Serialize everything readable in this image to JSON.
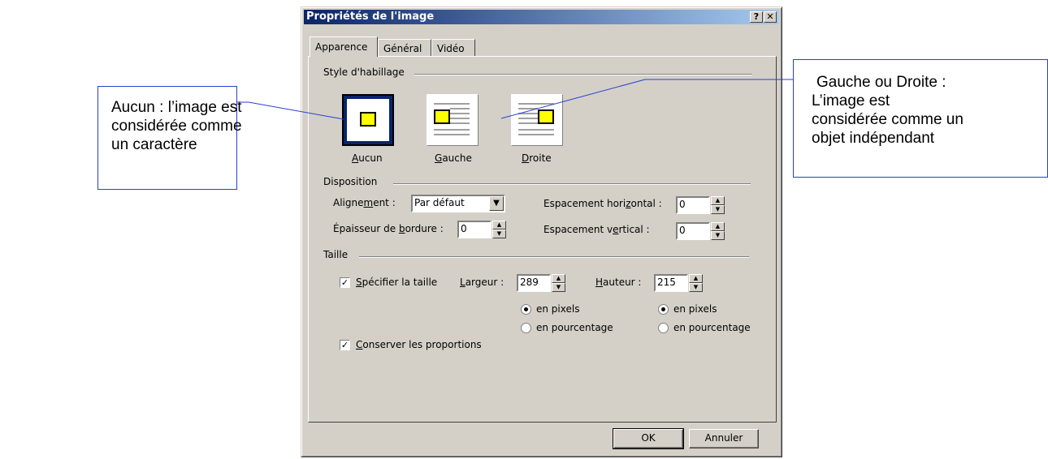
{
  "callouts": {
    "left": {
      "line1": "Aucun : l’image est",
      "line2": "considérée comme",
      "line3": "un caractère"
    },
    "right": {
      "line1": "Gauche ou Droite :",
      "line2": "L’image est",
      "line3": "considérée comme un",
      "line4": "objet indépendant"
    }
  },
  "dialog": {
    "title": "Propriétés de l'image",
    "help_label": "?",
    "close_label": "✕",
    "tabs": [
      {
        "label": "Apparence"
      },
      {
        "label": "Général"
      },
      {
        "label": "Vidéo"
      }
    ],
    "wrap_style": {
      "group_label": "Style d'habillage",
      "options": [
        {
          "label_ul": "A",
          "label_rest": "ucun"
        },
        {
          "label_ul": "G",
          "label_rest": "auche"
        },
        {
          "label_ul": "D",
          "label_rest": "roite"
        }
      ],
      "selected": "Aucun"
    },
    "layout": {
      "group_label": "Disposition",
      "alignment_pre": "Aligne",
      "alignment_ul": "m",
      "alignment_post": "ent :",
      "alignment_value": "Par défaut",
      "border_pre": "Épaisseur de ",
      "border_ul": "b",
      "border_post": "ordure :",
      "border_value": "0",
      "hspace_pre": "Espacement hori",
      "hspace_ul": "z",
      "hspace_post": "ontal :",
      "hspace_value": "0",
      "vspace_pre": "Espacement v",
      "vspace_ul": "e",
      "vspace_post": "rtical :",
      "vspace_value": "0"
    },
    "size": {
      "group_label": "Taille",
      "specify_ul": "S",
      "specify_rest": "pécifier la taille",
      "specify_checked": true,
      "width_ul": "L",
      "width_rest": "argeur :",
      "width_value": "289",
      "height_ul": "H",
      "height_rest": "auteur :",
      "height_value": "215",
      "in_pixels": "en pixels",
      "in_percent": "en pourcentage",
      "keep_ul": "C",
      "keep_rest": "onserver les proportions",
      "keep_checked": true
    },
    "buttons": {
      "ok": "OK",
      "cancel": "Annuler"
    }
  }
}
